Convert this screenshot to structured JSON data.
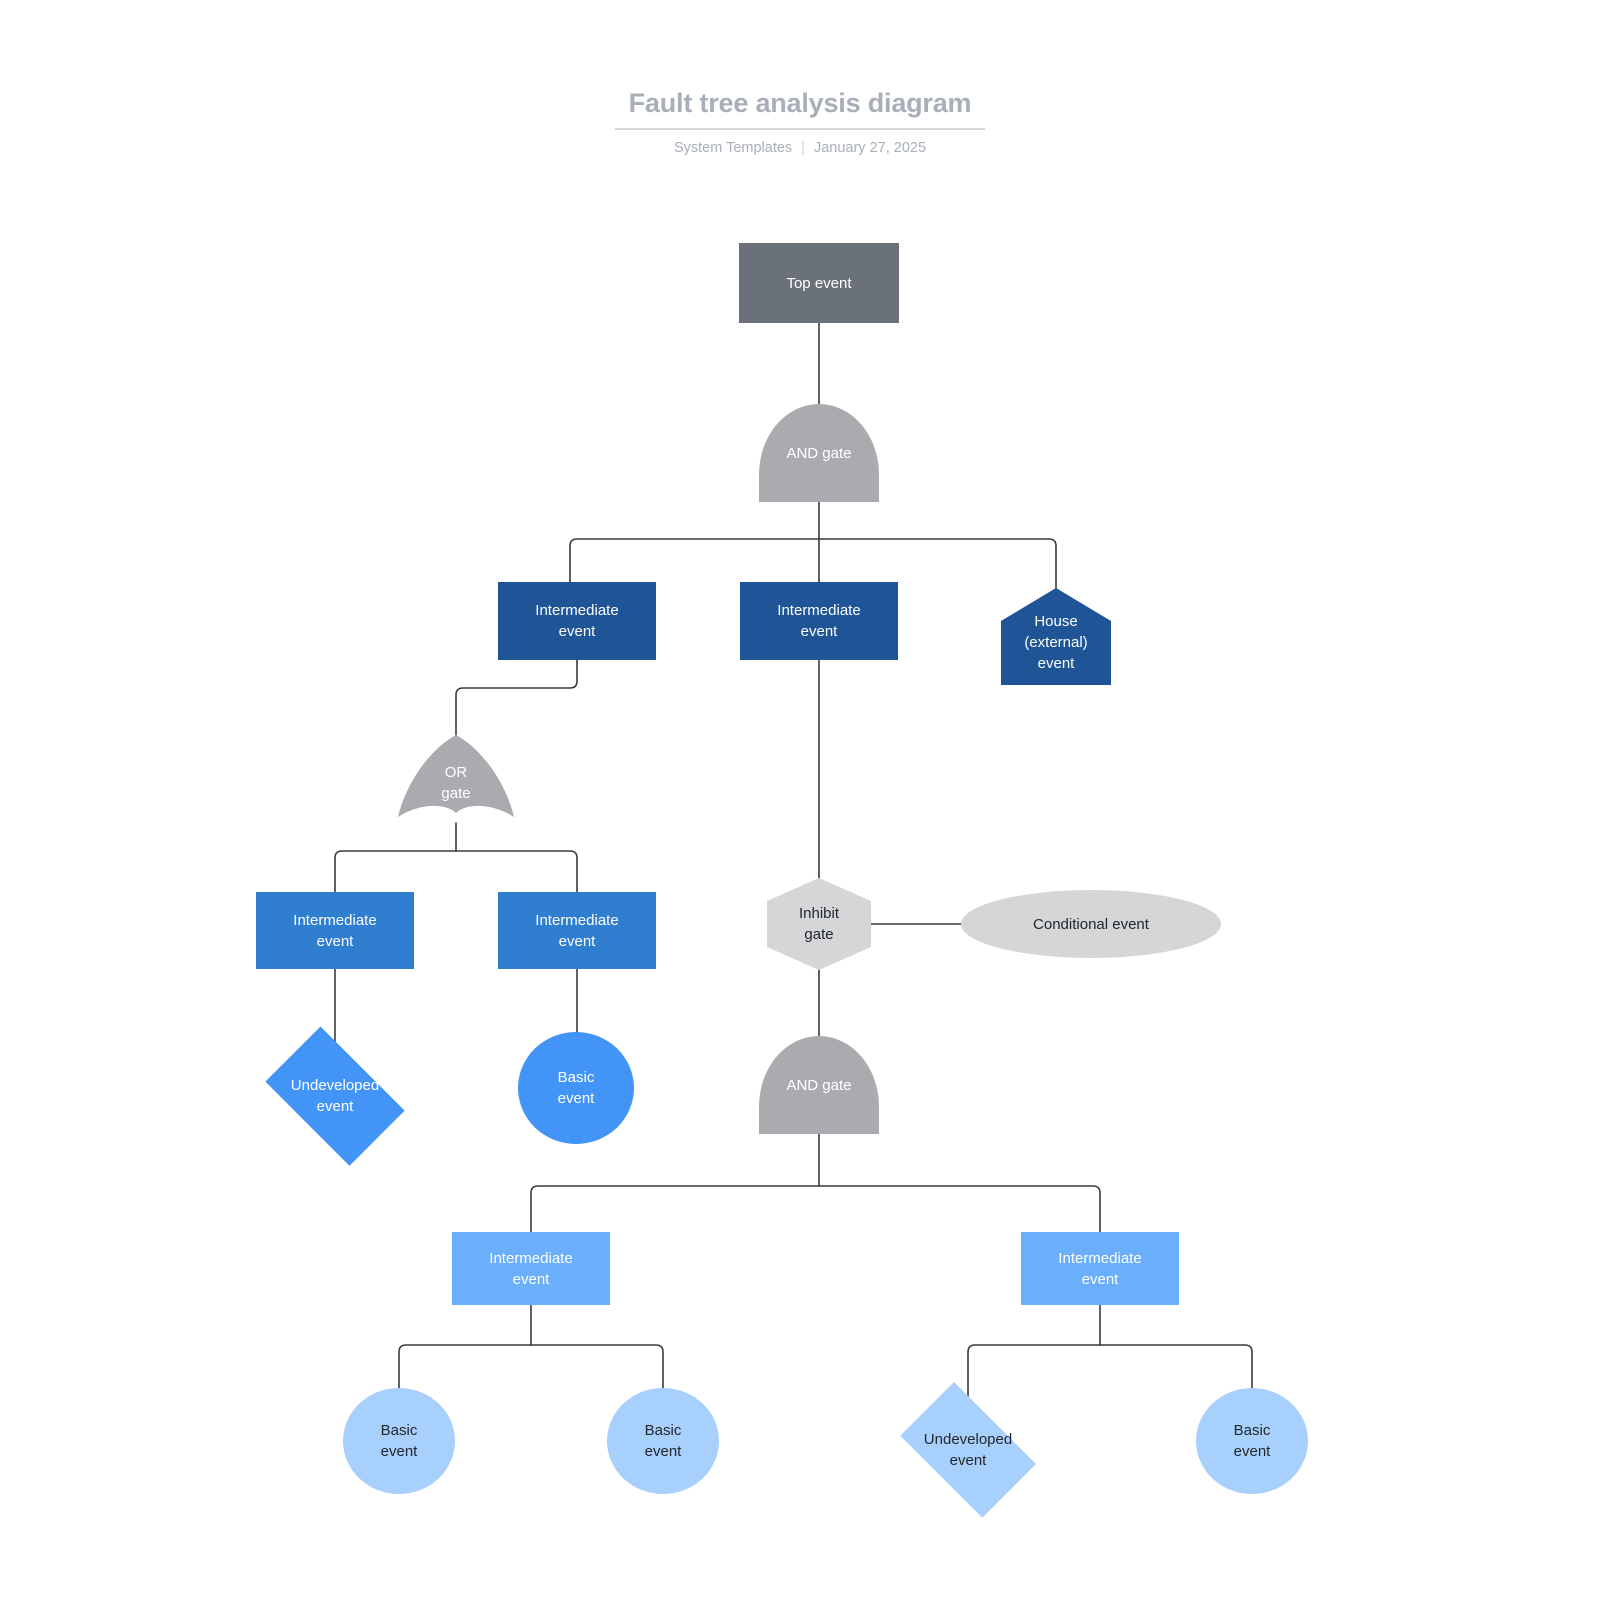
{
  "header": {
    "title": "Fault tree analysis diagram",
    "author": "System Templates",
    "separator": "|",
    "date": "January 27, 2025"
  },
  "palette": {
    "top_event": "#6b7179",
    "intermediate_dark": "#1f5596",
    "intermediate_mid": "#2f7ed0",
    "intermediate_light": "#6aaefc",
    "basic_bright": "#4294f7",
    "basic_pale": "#a8d0fd",
    "gate_gray": "#a9abae",
    "conditional_gray": "#d5d6d8",
    "connector": "#3a3a3a",
    "title_gray": "#a9afb8"
  },
  "nodes": {
    "top_event": {
      "label": "Top event",
      "type": "rect"
    },
    "and_gate_1": {
      "label": "AND gate",
      "type": "and-gate"
    },
    "intermediate_a": {
      "label": "Intermediate\nevent",
      "type": "rect"
    },
    "intermediate_b": {
      "label": "Intermediate\nevent",
      "type": "rect"
    },
    "house_event": {
      "label": "House\n(external)\nevent",
      "type": "house"
    },
    "or_gate": {
      "label": "OR\ngate",
      "type": "or-gate"
    },
    "intermediate_c": {
      "label": "Intermediate\nevent",
      "type": "rect"
    },
    "intermediate_d": {
      "label": "Intermediate\nevent",
      "type": "rect"
    },
    "undeveloped_1": {
      "label": "Undeveloped\nevent",
      "type": "diamond"
    },
    "basic_1": {
      "label": "Basic\nevent",
      "type": "circle"
    },
    "inhibit_gate": {
      "label": "Inhibit\ngate",
      "type": "hexagon"
    },
    "conditional_event": {
      "label": "Conditional event",
      "type": "ellipse"
    },
    "and_gate_2": {
      "label": "AND gate",
      "type": "and-gate"
    },
    "intermediate_e": {
      "label": "Intermediate\nevent",
      "type": "rect"
    },
    "intermediate_f": {
      "label": "Intermediate\nevent",
      "type": "rect"
    },
    "basic_2": {
      "label": "Basic\nevent",
      "type": "circle"
    },
    "basic_3": {
      "label": "Basic\nevent",
      "type": "circle"
    },
    "undeveloped_2": {
      "label": "Undeveloped\nevent",
      "type": "diamond"
    },
    "basic_4": {
      "label": "Basic\nevent",
      "type": "circle"
    }
  }
}
